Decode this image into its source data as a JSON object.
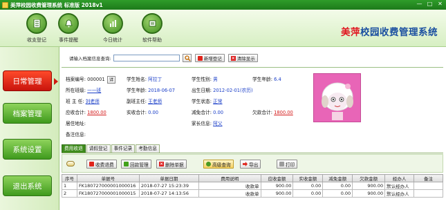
{
  "window": {
    "title": "美萍校园收费管理系统 标准版 2018v1",
    "controls": [
      "—",
      "□",
      "✕"
    ]
  },
  "toolbar": {
    "items": [
      {
        "label": "收支登记",
        "icon": "ledger-icon"
      },
      {
        "label": "事件提醒",
        "icon": "bell-icon"
      },
      {
        "label": "今日统计",
        "icon": "chart-icon"
      },
      {
        "label": "软件帮助",
        "icon": "help-icon"
      }
    ]
  },
  "brand": {
    "highlight": "美萍",
    "rest": "校园收费管理系统"
  },
  "nav": {
    "items": [
      {
        "label": "日常管理",
        "active": true
      },
      {
        "label": "档案管理",
        "active": false
      },
      {
        "label": "系统设置",
        "active": false
      },
      {
        "label": "退出系统",
        "active": false
      }
    ]
  },
  "search": {
    "label": "请输入档案信息查询:",
    "value": "",
    "add_label": "新增登记",
    "clear_label": "清除显示"
  },
  "student": {
    "archive_no_label": "档案编号:",
    "archive_no": "000001",
    "detail_label": "详",
    "name_label": "学生姓名:",
    "name": "阿拉丁",
    "gender_label": "学生性别:",
    "gender": "男",
    "age_label": "学生年龄:",
    "age": "6.4",
    "class_label": "所在班级:",
    "class": "一一班",
    "enroll_label": "学生年龄:",
    "enroll": "2018-06-07",
    "birth_label": "出生日期:",
    "birth": "2012-02-01(农历)",
    "head_teacher_label": "班 主 任:",
    "head_teacher": "刘老师",
    "sub_teacher_label": "副班主任:",
    "sub_teacher": "王老师",
    "status_label": "学生状态:",
    "status": "正常",
    "receivable_label": "应收合计:",
    "receivable": "1800.00",
    "paid_label": "实收合计:",
    "paid": "0.00",
    "reduce_label": "减免合计:",
    "reduce": "0.00",
    "owed_label": "欠款合计:",
    "owed": "1800.00",
    "address_label": "居住地址:",
    "address": "",
    "parent_label": "家长信息:",
    "parent": "阿父",
    "note_label": "备注信息:",
    "note": ""
  },
  "tabs": [
    {
      "label": "费用收退",
      "active": true
    },
    {
      "label": "请假登记",
      "active": false
    },
    {
      "label": "事件记录",
      "active": false
    },
    {
      "label": "考勤信息",
      "active": false
    }
  ],
  "grid_toolbar": {
    "charge_label": "收费退费",
    "reject_label": "回款管理",
    "delete_label": "删除单据",
    "query_label": "高级查询",
    "export_label": "导出",
    "print_label": "打印"
  },
  "table": {
    "headers": [
      "序号",
      "单据号",
      "单据日期",
      "费用说明",
      "应收金额",
      "实收金额",
      "减免金额",
      "欠款金额",
      "经办人",
      "备注"
    ],
    "rows": [
      [
        "1",
        "FK180727000001000016",
        "2018-07-27 15:23:39",
        "收款单",
        "900.00",
        "0.00",
        "0.00",
        "900.00",
        "默认经办人",
        ""
      ],
      [
        "2",
        "FK180727000001000015",
        "2018-07-27 14:13:56",
        "收款单",
        "900.00",
        "0.00",
        "0.00",
        "900.00",
        "默认经办人",
        ""
      ]
    ]
  }
}
